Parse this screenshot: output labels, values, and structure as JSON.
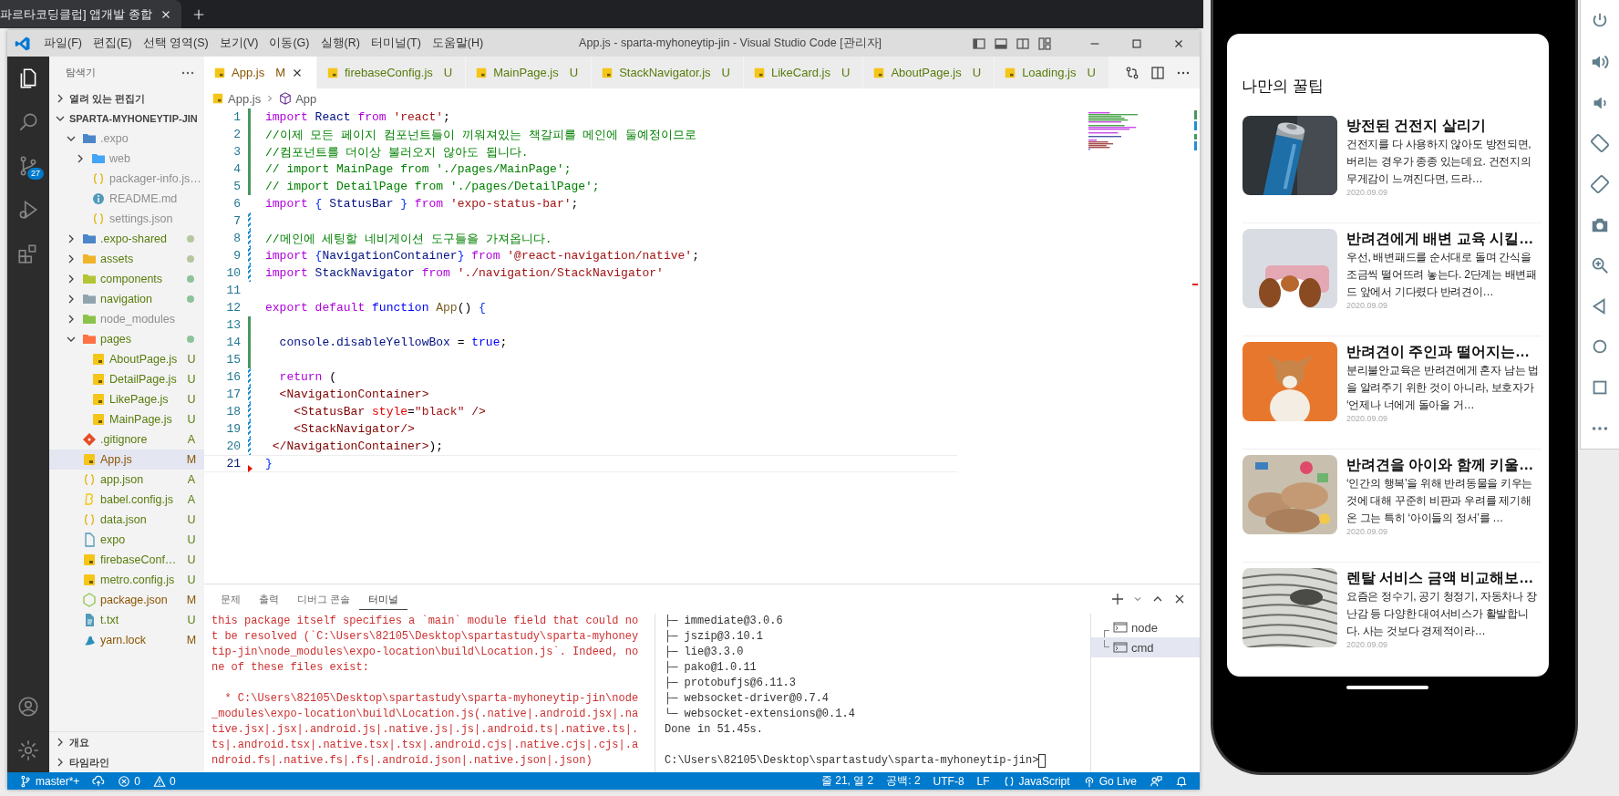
{
  "browser_tab": {
    "title": "파르타코딩클럽] 앱개발 종합"
  },
  "window": {
    "menu": [
      "파일(F)",
      "편집(E)",
      "선택 영역(S)",
      "보기(V)",
      "이동(G)",
      "실행(R)",
      "터미널(T)",
      "도움말(H)"
    ],
    "title": "App.js - sparta-myhoneytip-jin - Visual Studio Code [관리자]"
  },
  "activity_bar": {
    "source_control_badge": "27"
  },
  "sidebar": {
    "title": "탐색기",
    "sections": [
      {
        "label": "열려 있는 편집기",
        "expanded": false
      },
      {
        "label": "SPARTA-MYHONEYTIP-JIN",
        "expanded": true
      }
    ],
    "tree": [
      {
        "name": ".expo",
        "kind": "expo",
        "expanded": true,
        "selected": false,
        "ignored": true,
        "modified": false,
        "children": [
          {
            "name": "web",
            "kind": "web",
            "expanded": false,
            "selected": false,
            "ignored": true,
            "modified": false
          },
          {
            "name": "packager-info.js…",
            "kind": "json",
            "selected": false,
            "ignored": true,
            "modified": false
          },
          {
            "name": "README.md",
            "kind": "info",
            "selected": false,
            "ignored": true,
            "modified": false
          },
          {
            "name": "settings.json",
            "kind": "json",
            "selected": false,
            "ignored": true,
            "modified": false
          }
        ]
      },
      {
        "name": ".expo-shared",
        "kind": "expo",
        "expanded": false,
        "selected": false,
        "ignored": false,
        "modified": false,
        "color": "#b5c79f"
      },
      {
        "name": "assets",
        "kind": "assets",
        "expanded": false,
        "selected": false,
        "ignored": false,
        "modified": false,
        "color": "#b5c79f"
      },
      {
        "name": "components",
        "kind": "components",
        "expanded": false,
        "selected": false,
        "ignored": false,
        "modified": false,
        "color": "#8dc29a"
      },
      {
        "name": "navigation",
        "kind": "navigation",
        "expanded": false,
        "selected": false,
        "ignored": false,
        "modified": false,
        "color": "#8dc29a"
      },
      {
        "name": "node_modules",
        "kind": "modules",
        "expanded": false,
        "selected": false,
        "ignored": true,
        "modified": false
      },
      {
        "name": "pages",
        "kind": "pages",
        "expanded": true,
        "selected": false,
        "ignored": false,
        "modified": false,
        "color": "#8dc29a",
        "children": [
          {
            "name": "AboutPage.js",
            "kind": "js",
            "selected": false,
            "ignored": false,
            "modified": false,
            "status": "U"
          },
          {
            "name": "DetailPage.js",
            "kind": "js",
            "selected": false,
            "ignored": false,
            "modified": false,
            "status": "U"
          },
          {
            "name": "LikePage.js",
            "kind": "js",
            "selected": false,
            "ignored": false,
            "modified": false,
            "status": "U"
          },
          {
            "name": "MainPage.js",
            "kind": "js",
            "selected": false,
            "ignored": false,
            "modified": false,
            "status": "U"
          }
        ]
      },
      {
        "name": ".gitignore",
        "kind": "git",
        "selected": false,
        "ignored": false,
        "modified": false,
        "status": "A"
      },
      {
        "name": "App.js",
        "kind": "js",
        "selected": true,
        "ignored": false,
        "modified": true,
        "status": "M"
      },
      {
        "name": "app.json",
        "kind": "json",
        "selected": false,
        "ignored": false,
        "modified": false,
        "status": "A"
      },
      {
        "name": "babel.config.js",
        "kind": "babel",
        "selected": false,
        "ignored": false,
        "modified": false,
        "status": "A"
      },
      {
        "name": "data.json",
        "kind": "json",
        "selected": false,
        "ignored": false,
        "modified": false,
        "status": "U"
      },
      {
        "name": "expo",
        "kind": "file",
        "selected": false,
        "ignored": false,
        "modified": false,
        "status": "U"
      },
      {
        "name": "firebaseConf…",
        "kind": "js",
        "selected": false,
        "ignored": false,
        "modified": false,
        "status": "U"
      },
      {
        "name": "metro.config.js",
        "kind": "js",
        "selected": false,
        "ignored": false,
        "modified": false,
        "status": "U"
      },
      {
        "name": "package.json",
        "kind": "node",
        "selected": false,
        "ignored": false,
        "modified": true,
        "status": "M"
      },
      {
        "name": "t.txt",
        "kind": "text",
        "selected": false,
        "ignored": false,
        "modified": false,
        "status": "U"
      },
      {
        "name": "yarn.lock",
        "kind": "yarn",
        "selected": false,
        "ignored": false,
        "modified": true,
        "status": "M"
      }
    ],
    "bottom_sections": [
      {
        "label": "개요",
        "expanded": false
      },
      {
        "label": "타임라인",
        "expanded": false
      }
    ]
  },
  "tabs": [
    {
      "label": "App.js",
      "status": "M",
      "modified": true,
      "selected": true
    },
    {
      "label": "firebaseConfig.js",
      "status": "U",
      "modified": false,
      "selected": false
    },
    {
      "label": "MainPage.js",
      "status": "U",
      "modified": false,
      "selected": false
    },
    {
      "label": "StackNavigator.js",
      "status": "U",
      "modified": false,
      "selected": false
    },
    {
      "label": "LikeCard.js",
      "status": "U",
      "modified": false,
      "selected": false
    },
    {
      "label": "AboutPage.js",
      "status": "U",
      "modified": false,
      "selected": false
    },
    {
      "label": "Loading.js",
      "status": "U",
      "modified": false,
      "selected": false
    }
  ],
  "breadcrumb": [
    "App.js",
    "App"
  ],
  "code": {
    "lines": [
      {
        "number": "1",
        "kind": "added",
        "current": false,
        "tokens": [
          {
            "text": "import",
            "kind": "kw"
          },
          {
            "text": " React ",
            "kind": "id"
          },
          {
            "text": "from",
            "kind": "kw"
          },
          {
            "text": " 'react'",
            "kind": "str"
          },
          {
            "text": ";",
            "kind": "plain"
          }
        ]
      },
      {
        "number": "2",
        "kind": "added",
        "current": false,
        "tokens": [
          {
            "text": "//이제 모든 페이지 컴포넌트들이 끼워져있는 책갈피를 메인에 둘예정이므로",
            "kind": "comment"
          }
        ]
      },
      {
        "number": "3",
        "kind": "added",
        "current": false,
        "tokens": [
          {
            "text": "//컴포넌트를 더이상 불러오지 않아도 됩니다.",
            "kind": "comment"
          }
        ]
      },
      {
        "number": "4",
        "kind": "added",
        "current": false,
        "tokens": [
          {
            "text": "// import MainPage from './pages/MainPage';",
            "kind": "comment"
          }
        ]
      },
      {
        "number": "5",
        "kind": "added",
        "current": false,
        "tokens": [
          {
            "text": "// import DetailPage from './pages/DetailPage';",
            "kind": "comment"
          }
        ]
      },
      {
        "number": "6",
        "kind": "none",
        "current": false,
        "tokens": [
          {
            "text": "import ",
            "kind": "kw"
          },
          {
            "text": "{",
            "kind": "brace"
          },
          {
            "text": " StatusBar ",
            "kind": "id"
          },
          {
            "text": "}",
            "kind": "brace"
          },
          {
            "text": " from",
            "kind": "kw"
          },
          {
            "text": " 'expo-status-bar'",
            "kind": "str"
          },
          {
            "text": ";",
            "kind": "plain"
          }
        ]
      },
      {
        "number": "7",
        "kind": "modified",
        "current": false
      },
      {
        "number": "8",
        "kind": "modified",
        "current": false,
        "tokens": [
          {
            "text": "//메인에 세팅할 네비게이션 도구들을 가져옵니다.",
            "kind": "comment"
          }
        ]
      },
      {
        "number": "9",
        "kind": "modified",
        "current": false,
        "tokens": [
          {
            "text": "import ",
            "kind": "kw"
          },
          {
            "text": "{",
            "kind": "brace"
          },
          {
            "text": "NavigationContainer",
            "kind": "id"
          },
          {
            "text": "}",
            "kind": "brace"
          },
          {
            "text": " from",
            "kind": "kw"
          },
          {
            "text": " '@react-navigation/native'",
            "kind": "str"
          },
          {
            "text": ";",
            "kind": "plain"
          }
        ]
      },
      {
        "number": "10",
        "kind": "modified",
        "current": false,
        "tokens": [
          {
            "text": "import",
            "kind": "kw"
          },
          {
            "text": " StackNavigator ",
            "kind": "id"
          },
          {
            "text": "from",
            "kind": "kw"
          },
          {
            "text": " './navigation/StackNavigator'",
            "kind": "str"
          }
        ]
      },
      {
        "number": "11",
        "kind": "none",
        "current": false
      },
      {
        "number": "12",
        "kind": "none",
        "current": false,
        "tokens": [
          {
            "text": "export default ",
            "kind": "kw"
          },
          {
            "text": "function",
            "kind": "decl"
          },
          {
            "text": " App",
            "kind": "fn"
          },
          {
            "text": "() ",
            "kind": "plain"
          },
          {
            "text": "{",
            "kind": "brace"
          }
        ]
      },
      {
        "number": "13",
        "kind": "added",
        "current": false
      },
      {
        "number": "14",
        "kind": "added",
        "current": false,
        "tokens": [
          {
            "text": "  console.disableYellowBox ",
            "kind": "id"
          },
          {
            "text": "= ",
            "kind": "plain"
          },
          {
            "text": "true",
            "kind": "decl"
          },
          {
            "text": ";",
            "kind": "plain"
          }
        ]
      },
      {
        "number": "15",
        "kind": "added",
        "current": false
      },
      {
        "number": "16",
        "kind": "modified",
        "current": false,
        "tokens": [
          {
            "text": "  return",
            "kind": "kw"
          },
          {
            "text": " (",
            "kind": "plain"
          }
        ]
      },
      {
        "number": "17",
        "kind": "modified",
        "current": false,
        "tokens": [
          {
            "text": "  <",
            "kind": "punct"
          },
          {
            "text": "NavigationContainer",
            "kind": "tag"
          },
          {
            "text": ">",
            "kind": "punct"
          }
        ]
      },
      {
        "number": "18",
        "kind": "modified",
        "current": false,
        "tokens": [
          {
            "text": "    <",
            "kind": "punct"
          },
          {
            "text": "StatusBar ",
            "kind": "tag"
          },
          {
            "text": "style",
            "kind": "attr"
          },
          {
            "text": "=",
            "kind": "plain"
          },
          {
            "text": "\"black\"",
            "kind": "str"
          },
          {
            "text": " />",
            "kind": "punct"
          }
        ]
      },
      {
        "number": "19",
        "kind": "modified",
        "current": false,
        "tokens": [
          {
            "text": "    <",
            "kind": "punct"
          },
          {
            "text": "StackNavigator",
            "kind": "tag"
          },
          {
            "text": "/>",
            "kind": "punct"
          }
        ]
      },
      {
        "number": "20",
        "kind": "modified",
        "current": false,
        "tokens": [
          {
            "text": " </",
            "kind": "punct"
          },
          {
            "text": "NavigationContainer",
            "kind": "tag"
          },
          {
            "text": ">",
            "kind": "punct"
          },
          {
            "text": ");",
            "kind": "plain"
          }
        ]
      },
      {
        "number": "21",
        "kind": "deleted",
        "current": true,
        "tokens": [
          {
            "text": "}",
            "kind": "brace"
          }
        ]
      }
    ]
  },
  "panel": {
    "tabs": [
      {
        "label": "문제",
        "selected": false
      },
      {
        "label": "출력",
        "selected": false
      },
      {
        "label": "디버그 콘솔",
        "selected": false
      },
      {
        "label": "터미널",
        "selected": true
      }
    ],
    "error_output": [
      [
        "this package itself specifies a `main` module field that could no",
        "t be resolved (`C:\\Users\\82105\\Desktop\\spartastudy\\sparta-myhoney",
        "tip-jin\\node_modules\\expo-location\\build\\Location.js`. Indeed, no",
        "ne of these files exist:"
      ],
      [
        "  * C:\\Users\\82105\\Desktop\\spartastudy\\sparta-myhoneytip-jin\\node",
        "_modules\\expo-location\\build\\Location.js(.native|.android.jsx|.na",
        "tive.jsx|.jsx|.android.js|.native.js|.js|.android.ts|.native.ts|.",
        "ts|.android.tsx|.native.tsx|.tsx|.android.cjs|.native.cjs|.cjs|.a",
        "ndroid.fs|.native.fs|.fs|.android.json|.native.json|.json)"
      ]
    ],
    "output": [
      [
        "├─ immediate@3.0.6",
        "├─ jszip@3.10.1",
        "├─ lie@3.3.0",
        "├─ pako@1.0.11",
        "├─ protobufjs@6.11.3",
        "├─ websocket-driver@0.7.4",
        "└─ websocket-extensions@0.1.4",
        "Done in 51.45s."
      ],
      [
        "C:\\Users\\82105\\Desktop\\spartastudy\\sparta-myhoneytip-jin>"
      ]
    ],
    "terminals": [
      {
        "name": "node",
        "selected": false
      },
      {
        "name": "cmd",
        "selected": true
      }
    ]
  },
  "status_bar": {
    "left": [
      {
        "kind": "branch",
        "text": "master*+"
      },
      {
        "kind": "sync"
      },
      {
        "kind": "errors",
        "text": "0"
      },
      {
        "kind": "warnings",
        "text": "0"
      }
    ],
    "right": [
      {
        "kind": "text",
        "text": "줄 21, 열 2"
      },
      {
        "kind": "text",
        "text": "공백: 2"
      },
      {
        "kind": "text",
        "text": "UTF-8"
      },
      {
        "kind": "text",
        "text": "LF"
      },
      {
        "kind": "language",
        "text": "JavaScript"
      },
      {
        "kind": "live",
        "text": "Go Live"
      },
      {
        "kind": "feedback"
      },
      {
        "kind": "bell"
      }
    ]
  },
  "phone": {
    "header": "나만의 꿀팁",
    "tips": [
      {
        "title": "방전된 건전지 살리기",
        "desc": "건전지를 다 사용하지 않아도 방전되면, 버리는 경우가 종종 있는데요. 건전지의 무게감이 느껴진다면, 드라…",
        "date": "2020.09.09"
      },
      {
        "title": "반려견에게 배변 교육 시킬…",
        "desc": "우선, 배변패드를 순서대로 돌며 간식을 조금씩 떨어뜨려 놓는다. 2단계는 배변패드 앞에서 기다렸다 반려견이…",
        "date": "2020.09.09"
      },
      {
        "title": "반려견이 주인과 떨어지는…",
        "desc": "분리불안교육은 반려견에게 혼자 남는 법을 알려주기 위한 것이 아니라, 보호자가 ‘언제나 너에게 돌아올 거…",
        "date": "2020.09.09"
      },
      {
        "title": "반려견을 아이와 함께 키울…",
        "desc": "‘인간의 행복’을 위해 반려동물을 키우는 것에 대해 꾸준히 비판과 우려를 제기해온 그는 특히 ‘아이들의 정서’를 …",
        "date": "2020.09.09"
      },
      {
        "title": "렌탈 서비스 금액 비교해보…",
        "desc": "요즘은 정수기, 공기 청정기, 자동차나 장난감 등 다양한 대여서비스가 활발합니다. 사는 것보다 경제적이라…",
        "date": "2020.09.09"
      }
    ]
  }
}
